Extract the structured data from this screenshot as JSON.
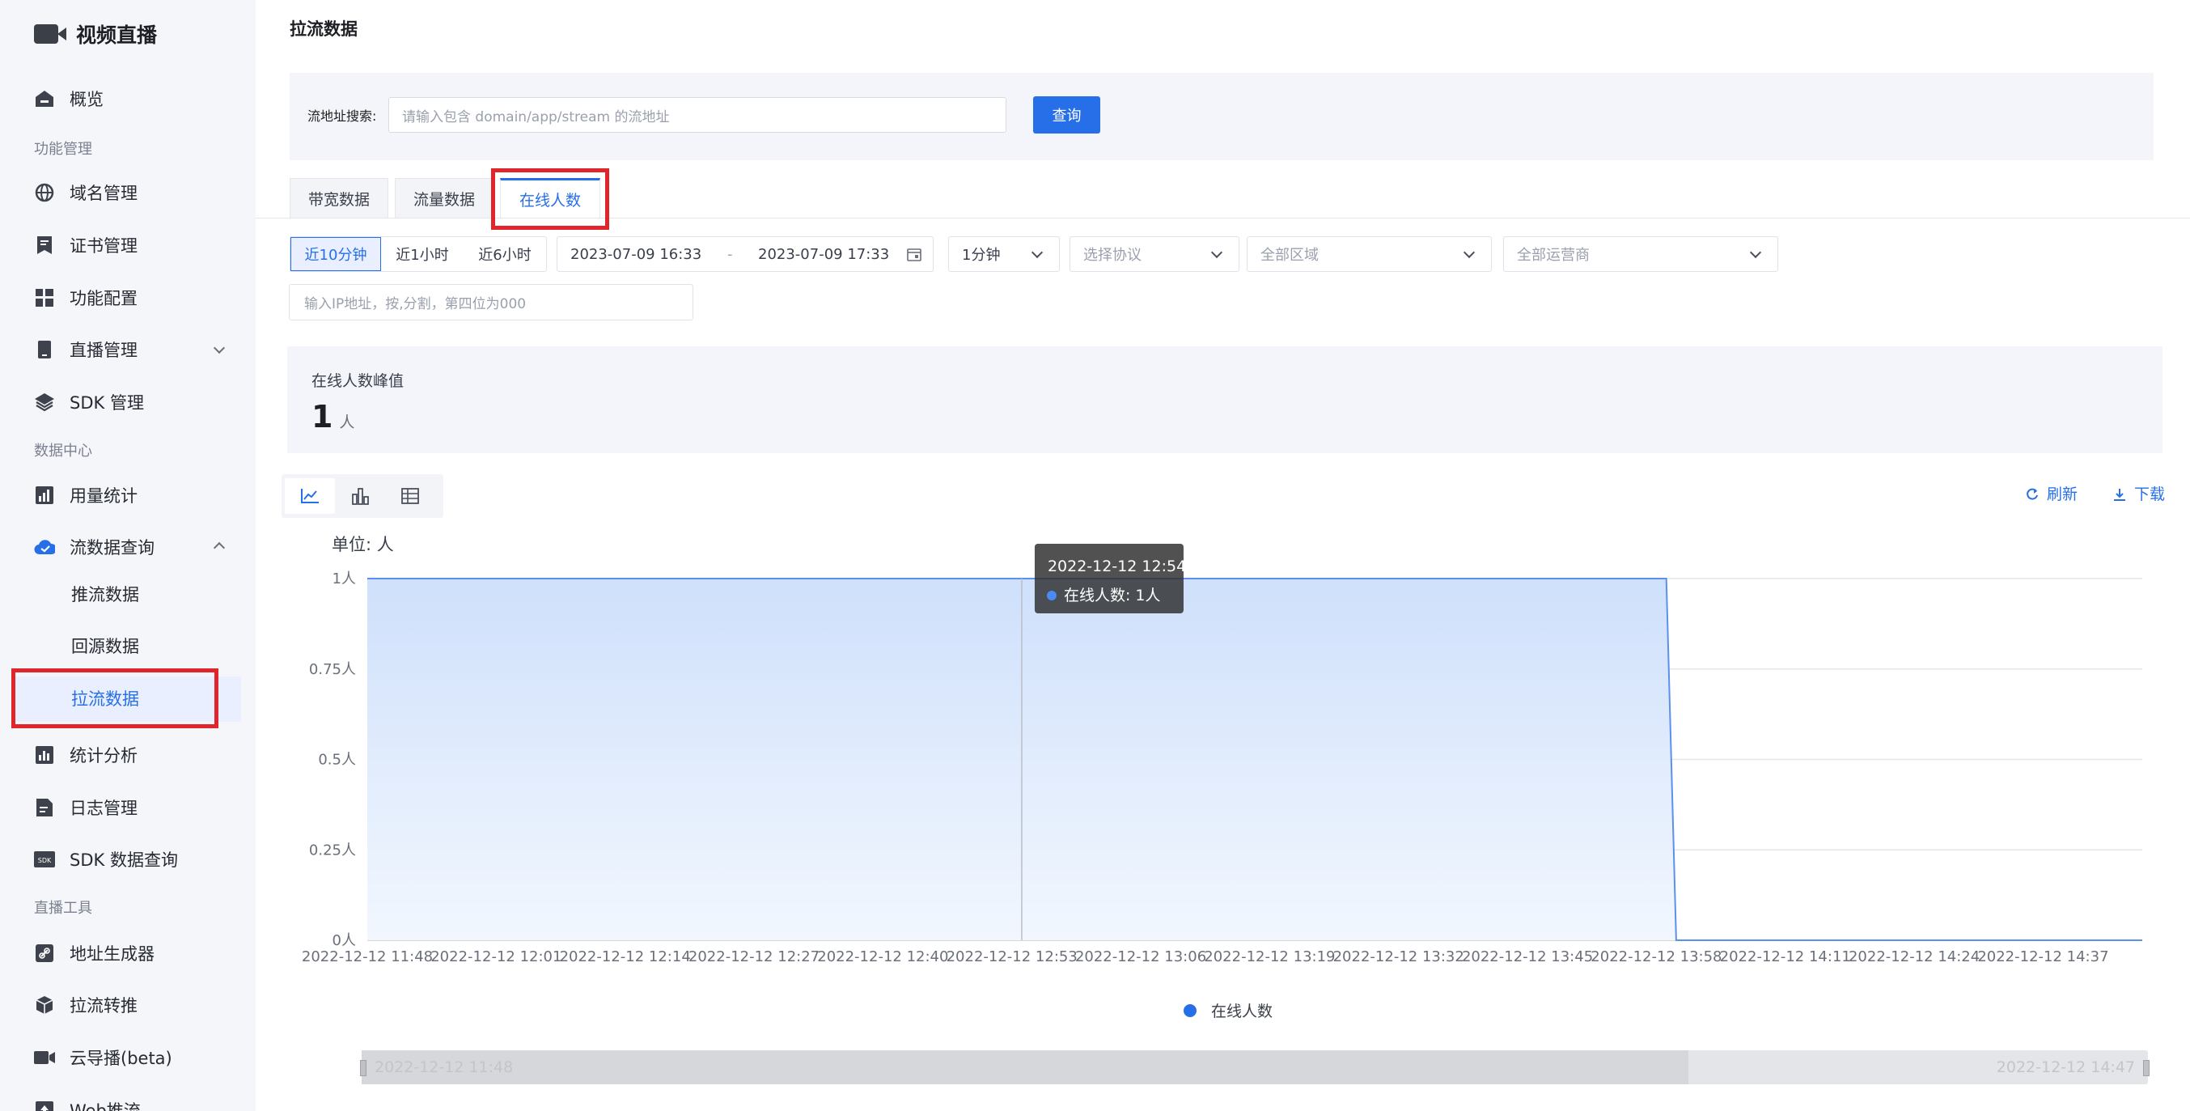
{
  "app": {
    "title": "视频直播"
  },
  "sidebar": {
    "overview": "概览",
    "section_features": "功能管理",
    "domain": "域名管理",
    "cert": "证书管理",
    "config": "功能配置",
    "live": "直播管理",
    "sdk": "SDK 管理",
    "section_data": "数据中心",
    "usage": "用量统计",
    "flow_query": "流数据查询",
    "push": "推流数据",
    "origin": "回源数据",
    "pull": "拉流数据",
    "stats": "统计分析",
    "logs": "日志管理",
    "sdk_query": "SDK 数据查询",
    "section_tools": "直播工具",
    "addr_gen": "地址生成器",
    "relay": "拉流转推",
    "cloud": "云导播(beta)",
    "web_push": "Web推流"
  },
  "page": {
    "title": "拉流数据"
  },
  "search": {
    "label": "流地址搜索:",
    "placeholder": "请输入包含 domain/app/stream 的流地址",
    "button": "查询"
  },
  "tabs": [
    "带宽数据",
    "流量数据",
    "在线人数"
  ],
  "filters": {
    "ranges": [
      "近10分钟",
      "近1小时",
      "近6小时"
    ],
    "start": "2023-07-09 16:33",
    "sep": "-",
    "end": "2023-07-09 17:33",
    "granularity": "1分钟",
    "protocol": "选择协议",
    "region": "全部区域",
    "isp": "全部运营商",
    "ip_placeholder": "输入IP地址，按,分割，第四位为000"
  },
  "peak": {
    "label": "在线人数峰值",
    "value": "1",
    "unit": "人"
  },
  "actions": {
    "refresh": "刷新",
    "download": "下载"
  },
  "colors": {
    "accent": "#266fe8",
    "area": "#d3e2fb",
    "highlight": "#e1252d"
  },
  "icons": [
    "line-chart-icon",
    "bar-chart-icon",
    "table-icon",
    "refresh-icon",
    "download-icon"
  ],
  "chart_data": {
    "type": "area",
    "unit_label": "单位: 人",
    "x_labels": [
      "2022-12-12 11:48",
      "2022-12-12 12:01",
      "2022-12-12 12:14",
      "2022-12-12 12:27",
      "2022-12-12 12:40",
      "2022-12-12 12:53",
      "2022-12-12 13:06",
      "2022-12-12 13:19",
      "2022-12-12 13:32",
      "2022-12-12 13:45",
      "2022-12-12 13:58",
      "2022-12-12 14:11",
      "2022-12-12 14:24",
      "2022-12-12 14:37"
    ],
    "y_ticks": [
      "1人",
      "0.75人",
      "0.5人",
      "0.25人",
      "0人"
    ],
    "ylim": [
      0,
      1
    ],
    "series": [
      {
        "name": "在线人数",
        "x": [
          "2022-12-12 11:48",
          "2022-12-12 13:59",
          "2022-12-12 14:00",
          "2022-12-12 14:47"
        ],
        "values": [
          1,
          1,
          0,
          0
        ]
      }
    ],
    "tooltip": {
      "time": "2022-12-12 12:54",
      "text": "在线人数: 1人"
    },
    "zoom_range": [
      "2022-12-12 11:48",
      "2022-12-12 14:47"
    ]
  }
}
